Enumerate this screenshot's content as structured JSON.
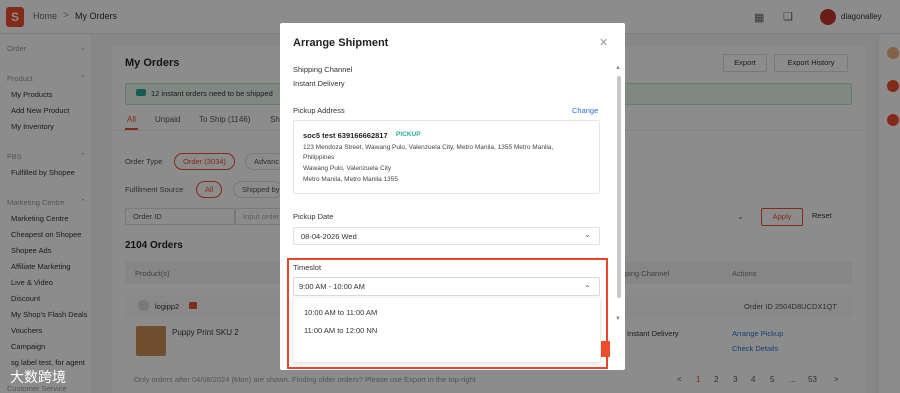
{
  "topbar": {
    "logo_letter": "S",
    "home_label": "Home",
    "separator": ">",
    "current_label": "My Orders",
    "username": "diagonalley"
  },
  "sidebar": {
    "sections": [
      {
        "label": "Order",
        "items": []
      },
      {
        "label": "Product",
        "items": [
          "My Products",
          "Add New Product",
          "My Inventory"
        ]
      },
      {
        "label": "FBS",
        "items": [
          "Fulfilled by Shopee"
        ]
      },
      {
        "label": "Marketing Centre",
        "items": [
          "Marketing Centre",
          "Cheapest on Shopee",
          "Shopee Ads",
          "Affiliate Marketing",
          "Live & Video",
          "Discount",
          "My Shop's Flash Deals",
          "Vouchers",
          "Campaign",
          "sg label test, for agent"
        ]
      },
      {
        "label": "Customer Service",
        "items": []
      }
    ]
  },
  "main": {
    "title": "My Orders",
    "export_label": "Export",
    "export_history_label": "Export History",
    "banner_text": "12 instant orders need to be shipped",
    "tabs": [
      "All",
      "Unpaid",
      "To Ship (1146)",
      "Sh"
    ],
    "order_type_label": "Order Type",
    "order_type_active": "Order (3034)",
    "order_type_other": "Advanc",
    "fulfilment_label": "Fulfilment Source",
    "fulfilment_active": "All",
    "fulfilment_other": "Shipped by",
    "search_field": "Order ID",
    "search_placeholder": "Input order",
    "apply_label": "Apply",
    "reset_label": "Reset",
    "count_title": "2104 Orders",
    "columns": {
      "products": "Product(s)",
      "shipping_channel": "Shipping Channel",
      "actions": "Actions"
    },
    "order": {
      "buyer": "logipp2",
      "order_id": "Order ID 2504D8UCDX1QT",
      "product": "Puppy Print SKU 2",
      "delivery": "Instant Delivery",
      "arrange_pickup": "Arrange Pickup",
      "check_details": "Check Details"
    },
    "footer_note": "Only orders after 04/08/2024 (Mon) are shown. Finding older orders? Please use Export in the top-right",
    "pagination": [
      "<",
      "1",
      "2",
      "3",
      "4",
      "5",
      "...",
      "53",
      ">"
    ],
    "current_page": "1"
  },
  "modal": {
    "title": "Arrange Shipment",
    "close_glyph": "✕",
    "shipping_channel_label": "Shipping Channel",
    "shipping_channel_value": "Instant Delivery",
    "pickup_address_label": "Pickup Address",
    "change_label": "Change",
    "address": {
      "name": "soc5 test 639166662817",
      "tag": "PICKUP",
      "line1": "123 Mendoza Street, Wawang Pulo, Valenzuela City, Metro Manila, 1355 Metro Manila,",
      "line2": "Philippines",
      "line3": "Wawang Pulo, Valenzuela City",
      "line4": "Metro Manila, Metro Manila 1355"
    },
    "pickup_date_label": "Pickup Date",
    "pickup_date_value": "08-04-2026 Wed",
    "timeslot_label": "Timeslot",
    "timeslot_value": "9:00 AM - 10:00 AM",
    "timeslot_options": [
      "10:00 AM to 11:00 AM",
      "11:00 AM to 12:00 NN"
    ]
  },
  "watermark": "大数跨境",
  "colors": {
    "brand": "#ee4d2d",
    "link": "#2673dd",
    "highlight": "#e8462b",
    "success": "#26aa99"
  }
}
